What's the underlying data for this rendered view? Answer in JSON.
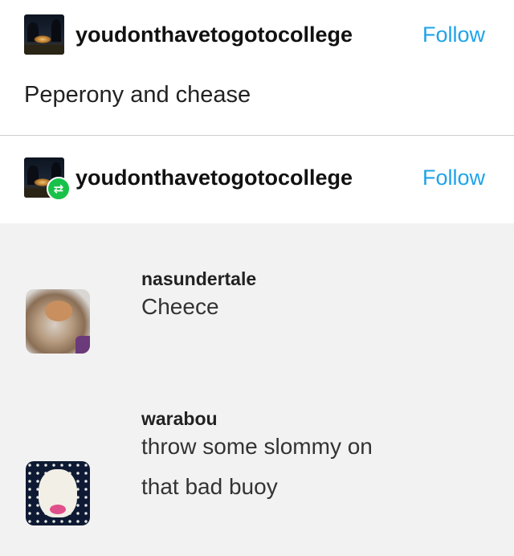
{
  "post": {
    "username": "youdonthavetogotocollege",
    "follow_label": "Follow",
    "text": "Peperony and chease"
  },
  "reblog": {
    "username": "youdonthavetogotocollege",
    "follow_label": "Follow"
  },
  "notes": [
    {
      "username": "nasundertale",
      "text": "Cheece"
    },
    {
      "username": "warabou",
      "line1": "throw some slommy on",
      "line2": "that bad buoy"
    }
  ],
  "colors": {
    "follow": "#1fa3e8",
    "reblog_badge": "#18c24a",
    "notes_bg": "#f2f2f2"
  },
  "icons": {
    "reblog": "reblog-icon"
  }
}
